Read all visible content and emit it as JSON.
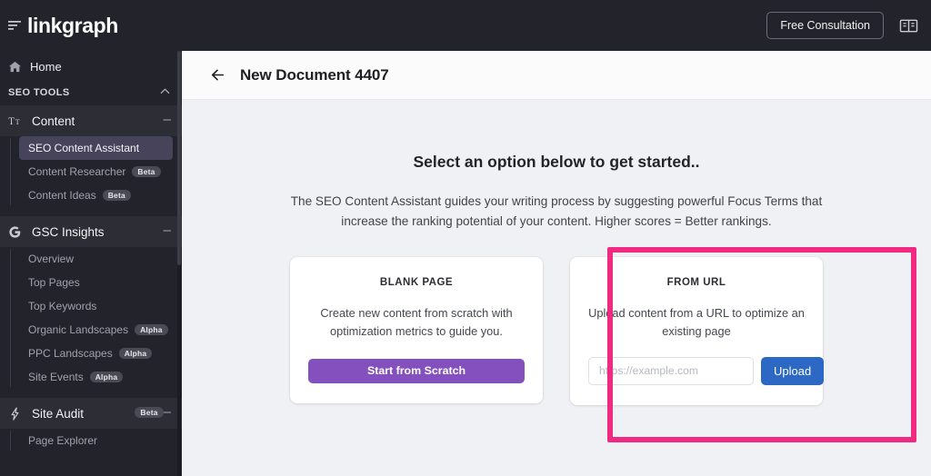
{
  "brand": {
    "name": "linkgraph",
    "logo_icon": "hamburger-lines-icon"
  },
  "topbar": {
    "consultation_label": "Free Consultation",
    "book_icon": "open-book-icon"
  },
  "page_header": {
    "back_icon": "arrow-left-icon",
    "title": "New Document 4407"
  },
  "sidebar": {
    "home": {
      "label": "Home",
      "icon": "home-icon"
    },
    "section_label": "SEO TOOLS",
    "section_chevron": "chevron-up-icon",
    "groups": [
      {
        "label": "Content",
        "icon": "text-format-icon",
        "collapse_icon": "minus-icon",
        "items": [
          {
            "label": "SEO Content Assistant",
            "badge": "",
            "active": true
          },
          {
            "label": "Content Researcher",
            "badge": "Beta",
            "active": false
          },
          {
            "label": "Content Ideas",
            "badge": "Beta",
            "active": false
          }
        ]
      },
      {
        "label": "GSC Insights",
        "icon": "google-g-icon",
        "collapse_icon": "minus-icon",
        "badge": "",
        "items": [
          {
            "label": "Overview",
            "badge": "",
            "active": false
          },
          {
            "label": "Top Pages",
            "badge": "",
            "active": false
          },
          {
            "label": "Top Keywords",
            "badge": "",
            "active": false
          },
          {
            "label": "Organic Landscapes",
            "badge": "Alpha",
            "active": false
          },
          {
            "label": "PPC Landscapes",
            "badge": "Alpha",
            "active": false
          },
          {
            "label": "Site Events",
            "badge": "Alpha",
            "active": false
          }
        ]
      },
      {
        "label": "Site Audit",
        "icon": "lightning-bolt-icon",
        "collapse_icon": "minus-icon",
        "badge": "Beta",
        "items": [
          {
            "label": "Page Explorer",
            "badge": "",
            "active": false
          }
        ]
      }
    ]
  },
  "main": {
    "heading": "Select an option below to get started..",
    "description": "The SEO Content Assistant guides your writing process by suggesting powerful Focus Terms that increase the ranking potential of your content. Higher scores = Better rankings.",
    "cards": [
      {
        "title": "BLANK PAGE",
        "description": "Create new content from scratch with optimization metrics to guide you.",
        "button_label": "Start from Scratch"
      },
      {
        "title": "FROM URL",
        "description": "Upload content from a URL to optimize an existing page",
        "input_value": "",
        "input_placeholder": "https://example.com",
        "button_label": "Upload"
      }
    ]
  },
  "colors": {
    "sidebar_bg": "#23242B",
    "active_item_bg": "#46435A",
    "purple_button": "#8350BE",
    "blue_button": "#2C68C4",
    "highlight_pink": "#EF2A80",
    "content_bg": "#F0F1F4"
  }
}
